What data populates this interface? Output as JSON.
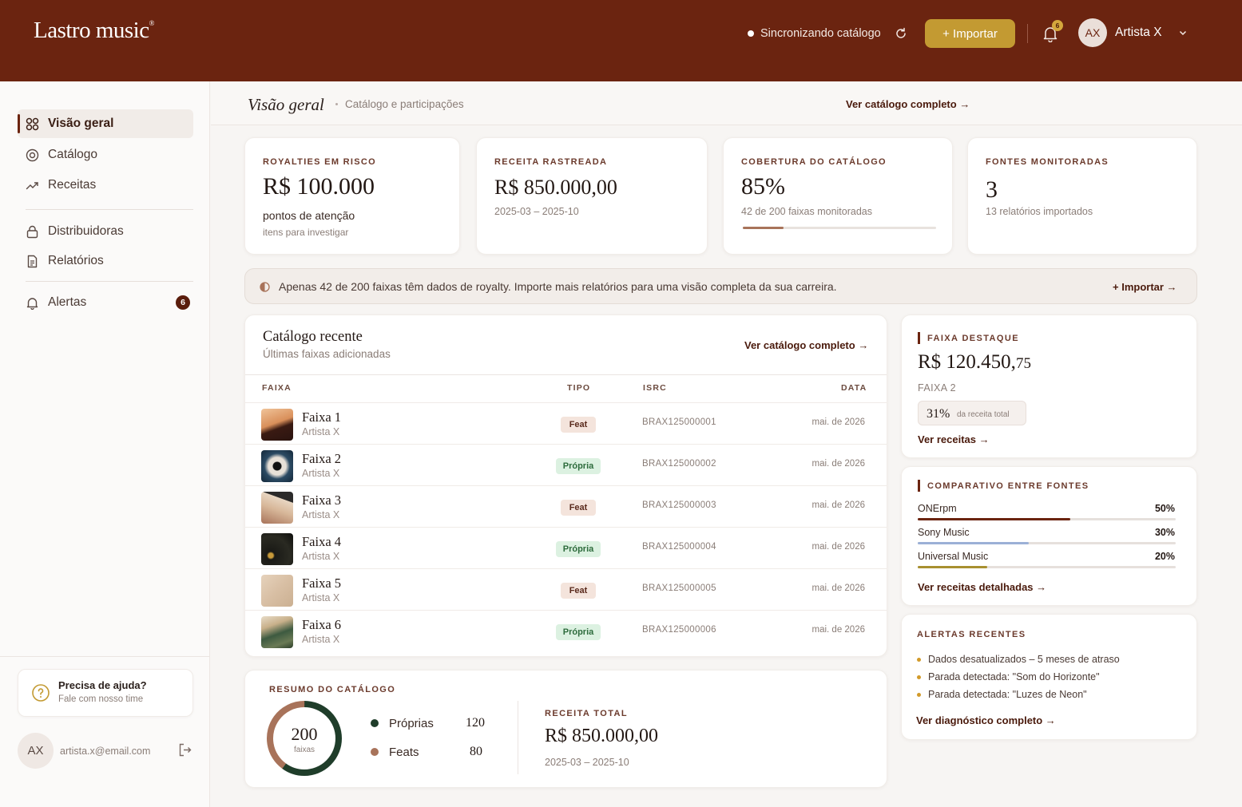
{
  "header": {
    "logo": "Lastro music",
    "logo_mark": "®",
    "sync_status": "Sincronizando catálogo",
    "import_label": "+ Importar",
    "notifications_count": "6",
    "user_initials": "AX",
    "user_name": "Artista X"
  },
  "sidebar": {
    "items": [
      {
        "label": "Visão geral",
        "icon": "grid-icon",
        "active": true
      },
      {
        "label": "Catálogo",
        "icon": "disc-icon"
      },
      {
        "label": "Receitas",
        "icon": "trend-icon"
      },
      {
        "label": "Distribuidoras",
        "icon": "lock-icon"
      },
      {
        "label": "Relatórios",
        "icon": "document-icon"
      },
      {
        "label": "Alertas",
        "icon": "bell-icon",
        "badge": "6"
      }
    ],
    "help_title": "Precisa de ajuda?",
    "help_sub": "Fale com nosso time",
    "user_initials": "AX",
    "user_email": "artista.x@email.com"
  },
  "page": {
    "title": "Visão geral",
    "breadcrumb": "Catálogo e participações",
    "view_catalog_link": "Ver catálogo completo →"
  },
  "kpis": [
    {
      "label": "ROYALTIES EM RISCO",
      "value": "R$ 100.000",
      "sub1": "pontos de atenção",
      "sub2": "itens para investigar"
    },
    {
      "label": "RECEITA RASTREADA",
      "value": "R$ 850.000,00",
      "sub1": "2025-03 – 2025-10"
    },
    {
      "label": "COBERTURA DO CATÁLOGO",
      "value": "85%",
      "sub1": "42 de 200 faixas monitoradas",
      "progress": 0.21
    },
    {
      "label": "FONTES MONITORADAS",
      "value": "3",
      "sub1": "13 relatórios importados"
    }
  ],
  "banner": {
    "text": "Apenas 42 de 200 faixas têm dados de royalty. Importe mais relatórios para uma visão completa da sua carreira.",
    "action": "+ Importar →"
  },
  "catalog": {
    "title": "Catálogo recente",
    "subtitle": "Últimas faixas adicionadas",
    "link": "Ver catálogo completo →",
    "columns": [
      "FAIXA",
      "TIPO",
      "ISRC",
      "DATA"
    ],
    "rows": [
      {
        "name": "Faixa 1",
        "artist": "Artista X",
        "type": "Feat",
        "isrc": "BRAX125000001",
        "date": "mai. de 2026"
      },
      {
        "name": "Faixa 2",
        "artist": "Artista X",
        "type": "Própria",
        "isrc": "BRAX125000002",
        "date": "mai. de 2026"
      },
      {
        "name": "Faixa 3",
        "artist": "Artista X",
        "type": "Feat",
        "isrc": "BRAX125000003",
        "date": "mai. de 2026"
      },
      {
        "name": "Faixa 4",
        "artist": "Artista X",
        "type": "Própria",
        "isrc": "BRAX125000004",
        "date": "mai. de 2026"
      },
      {
        "name": "Faixa 5",
        "artist": "Artista X",
        "type": "Feat",
        "isrc": "BRAX125000005",
        "date": "mai. de 2026"
      },
      {
        "name": "Faixa 6",
        "artist": "Artista X",
        "type": "Própria",
        "isrc": "BRAX125000006",
        "date": "mai. de 2026"
      }
    ]
  },
  "summary": {
    "label": "RESUMO DO CATÁLOGO",
    "total": "200",
    "total_unit": "faixas",
    "own_label": "Próprias",
    "own_value": "120",
    "feat_label": "Feats",
    "feat_value": "80",
    "revenue_label": "RECEITA TOTAL",
    "revenue_value": "R$ 850.000,00",
    "revenue_period": "2025-03 – 2025-10",
    "colors": {
      "own": "#1f3d2a",
      "feat": "#a8735a"
    }
  },
  "featured": {
    "label": "FAIXA DESTAQUE",
    "value_main": "R$ 120.450,",
    "value_cents": "75",
    "track": "FAIXA 2",
    "share": "31%",
    "share_note": "da receita total",
    "link": "Ver receitas →"
  },
  "sources": {
    "label": "COMPARATIVO ENTRE FONTES",
    "items": [
      {
        "name": "ONErpm",
        "percent": "50%",
        "share": 0.59,
        "color": "#6b2410"
      },
      {
        "name": "Sony Music",
        "percent": "30%",
        "share": 0.43,
        "color": "#9bb0d6"
      },
      {
        "name": "Universal Music",
        "percent": "20%",
        "share": 0.27,
        "color": "#a89030"
      }
    ],
    "link": "Ver receitas detalhadas →"
  },
  "alerts": {
    "label": "ALERTAS RECENTES",
    "items": [
      "Dados desatualizados – 5 meses de atraso",
      "Parada detectada: \"Som do Horizonte\"",
      "Parada detectada: \"Luzes de Neon\""
    ],
    "link": "Ver diagnóstico completo →"
  }
}
